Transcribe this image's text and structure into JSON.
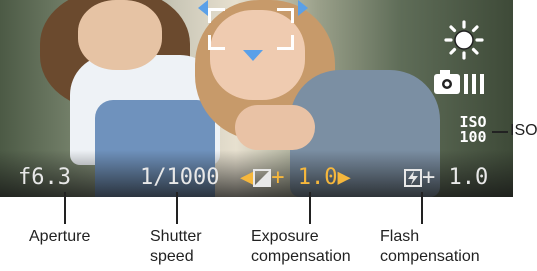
{
  "lcd": {
    "aperture": "f6.3",
    "shutter": "1/1000",
    "exposure_arrow_left": "◀",
    "exposure_value": "+ 1.0",
    "exposure_arrow_right": "▶",
    "flash_value": "+ 1.0",
    "iso_top": "ISO",
    "iso_bottom": "100"
  },
  "icons": {
    "white_balance": "sun-icon",
    "metering": "camera-burst-icon",
    "focus_frame": "focus-frame-icon"
  },
  "captions": {
    "iso": "ISO",
    "aperture": "Aperture",
    "shutter_line1": "Shutter",
    "shutter_line2": "speed",
    "exposure_line1": "Exposure",
    "exposure_line2": "compensation",
    "flash_line1": "Flash",
    "flash_line2": "compensation"
  },
  "colors": {
    "lcd_text": "#e8e8e8",
    "exposure_text": "#f6b73c",
    "focus_marker": "#5aa0e8"
  }
}
